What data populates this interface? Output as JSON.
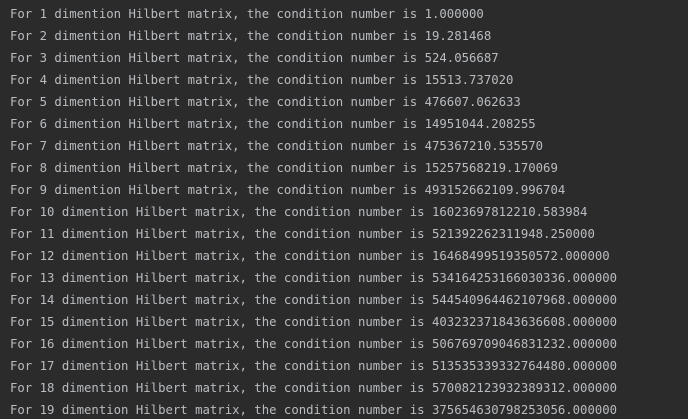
{
  "console": {
    "lines": [
      "For 1 dimention Hilbert matrix, the condition number is 1.000000",
      "For 2 dimention Hilbert matrix, the condition number is 19.281468",
      "For 3 dimention Hilbert matrix, the condition number is 524.056687",
      "For 4 dimention Hilbert matrix, the condition number is 15513.737020",
      "For 5 dimention Hilbert matrix, the condition number is 476607.062633",
      "For 6 dimention Hilbert matrix, the condition number is 14951044.208255",
      "For 7 dimention Hilbert matrix, the condition number is 475367210.535570",
      "For 8 dimention Hilbert matrix, the condition number is 15257568219.170069",
      "For 9 dimention Hilbert matrix, the condition number is 493152662109.996704",
      "For 10 dimention Hilbert matrix, the condition number is 16023697812210.583984",
      "For 11 dimention Hilbert matrix, the condition number is 521392262311948.250000",
      "For 12 dimention Hilbert matrix, the condition number is 16468499519350572.000000",
      "For 13 dimention Hilbert matrix, the condition number is 534164253166030336.000000",
      "For 14 dimention Hilbert matrix, the condition number is 544540964462107968.000000",
      "For 15 dimention Hilbert matrix, the condition number is 403232371843636608.000000",
      "For 16 dimention Hilbert matrix, the condition number is 506769709046831232.000000",
      "For 17 dimention Hilbert matrix, the condition number is 513535339332764480.000000",
      "For 18 dimention Hilbert matrix, the condition number is 570082123932389312.000000",
      "For 19 dimention Hilbert matrix, the condition number is 375654630798253056.000000"
    ],
    "colors": {
      "background": "#2b2b2b",
      "text": "#b9bcc0"
    }
  }
}
